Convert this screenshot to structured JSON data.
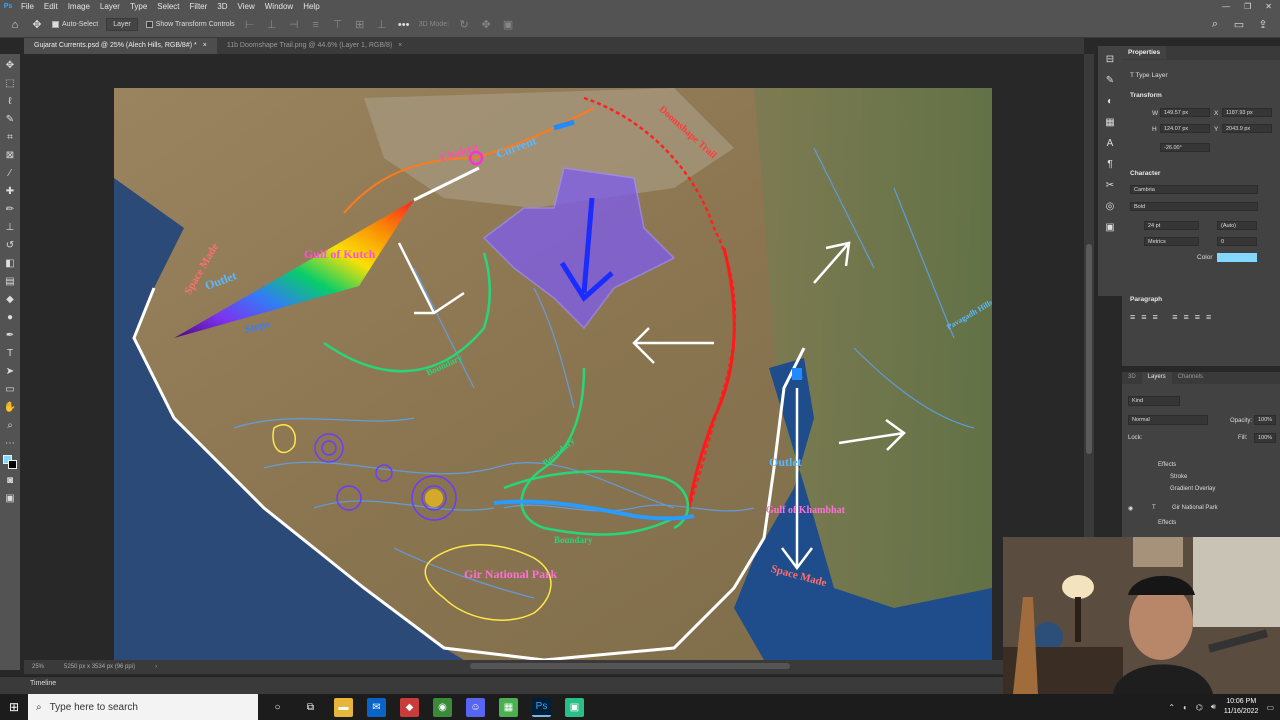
{
  "menubar": {
    "items": [
      "File",
      "Edit",
      "Image",
      "Layer",
      "Type",
      "Select",
      "Filter",
      "3D",
      "View",
      "Window",
      "Help"
    ],
    "window_controls": [
      "—",
      "❐",
      "✕"
    ]
  },
  "options_bar": {
    "auto_select_label": "Auto-Select",
    "auto_select_checked": true,
    "target_value": "Layer",
    "transform_controls_label": "Show Transform Controls",
    "mode_3d_label": "3D Mode:"
  },
  "tabs": [
    {
      "label": "Gujarat Currents.psd @ 25% (Alech Hills, RGB/8#) *",
      "active": true
    },
    {
      "label": "11b Doomshape Trail.png @ 44.6% (Layer 1, RGB/8)",
      "active": false
    }
  ],
  "map_labels": {
    "chakra": "Chakra",
    "current": "Current",
    "doomshape_trail": "Doomshape Trail",
    "space_made_left": "Space Made",
    "outlet_left": "Outlet",
    "gulf_of_kutch": "Gulf of Kutch",
    "steps": "Steps",
    "boundary_1": "Boundary",
    "boundary_2": "Boundary",
    "boundary_3": "Boundary",
    "gir_national_park": "Gir National Park",
    "outlet_right": "Outlet",
    "gulf_of_khambhat": "Gulf of Khambhat",
    "space_made_right": "Space Made",
    "pavagadh_hills": "Pavagadh Hills"
  },
  "status": {
    "zoom": "25%",
    "dimensions": "5250 px x 3534 px (96 ppi)"
  },
  "timeline_label": "Timeline",
  "properties": {
    "tab": "Properties",
    "type_layer": "Type Layer",
    "transform_title": "Transform",
    "w_label": "W",
    "w_value": "149.57 px",
    "x_label": "X",
    "x_value": "1187.93 px",
    "h_label": "H",
    "h_value": "124.07 px",
    "y_label": "Y",
    "y_value": "2043.9 px",
    "angle_value": "-26.00°",
    "character_title": "Character",
    "font_family": "Cambria",
    "font_style": "Bold",
    "font_size": "24 pt",
    "leading": "(Auto)",
    "kerning": "Metrics",
    "tracking": "0",
    "color_label": "Color",
    "paragraph_title": "Paragraph"
  },
  "layers_panel": {
    "tabs": [
      "3D",
      "Layers",
      "Channels"
    ],
    "active_tab": "Layers",
    "kind_filter": "Kind",
    "blend_mode": "Normal",
    "opacity_label": "Opacity:",
    "opacity_value": "100%",
    "lock_label": "Lock:",
    "fill_label": "Fill:",
    "fill_value": "100%",
    "rows": [
      {
        "name": "Effects",
        "level": 1
      },
      {
        "name": "Stroke",
        "level": 2
      },
      {
        "name": "Gradient Overlay",
        "level": 2
      },
      {
        "name": "Gir National Park",
        "level": 0,
        "type": "T"
      },
      {
        "name": "Effects",
        "level": 1
      }
    ]
  },
  "taskbar": {
    "search_placeholder": "Type here to search",
    "time": "10:06 PM",
    "date": "11/16/2022"
  }
}
